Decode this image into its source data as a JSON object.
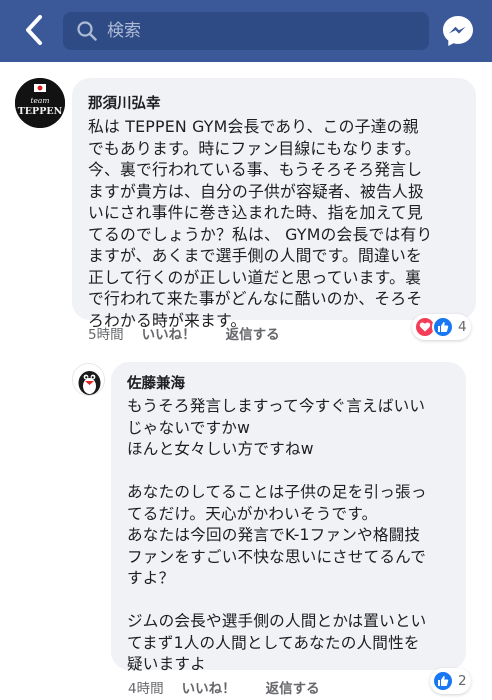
{
  "header": {
    "search_placeholder": "検索",
    "bar_color": "#3b5998"
  },
  "comments": [
    {
      "author": "那須川弘幸",
      "avatar_label": "team TEPPEN",
      "text": "私は TEPPEN GYM会長であり、この子達の親\nでもあります。時にファン目線にもなります。\n今、裏で行われている事、もうそろそろ発言し\nますが貴方は、自分の子供が容疑者、被告人扱\nいにされ事件に巻き込まれた時、指を加えて見\nてるのでしょうか？私は、 GYMの会長では有り\nますが、あくまで選手側の人間です。間違いを\n正して行くのが正しい道だと思っています。裏\nで行われて来た事がどんなに酷いのか、そろそ\nろわかる時が来ます。",
      "time": "5時間",
      "like_label": "いいね！",
      "reply_label": "返信する",
      "reaction_count": "4"
    },
    {
      "author": "佐藤兼海",
      "text": "もうそろ発言しますって今すぐ言えばいい\nじゃないですかw\nほんと女々しい方ですねw\n\nあなたのしてることは子供の足を引っ張っ\nてるだけ。天心がかわいそうです。\nあなたは今回の発言でK-1ファンや格闘技\nファンをすごい不快な思いにさせてるんで\nすよ？\n\nジムの会長や選手側の人間とかは置いとい\nてまず1人の人間としてあなたの人間性を\n疑いますよ",
      "time": "4時間",
      "like_label": "いいね！",
      "reply_label": "返信する",
      "reaction_count": "2"
    }
  ],
  "colors": {
    "bubble": "#f0f2f5",
    "like": "#1877f2",
    "heart": "#f33e58",
    "meta": "#65676b"
  }
}
